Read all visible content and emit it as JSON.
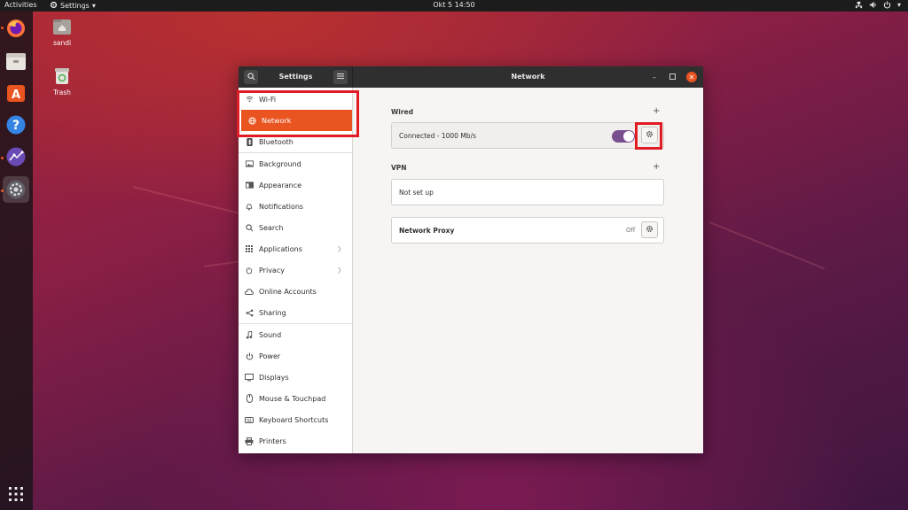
{
  "topbar": {
    "activities": "Activities",
    "app_menu": "Settings",
    "clock": "Okt 5  14:50"
  },
  "desktop": {
    "icons": [
      {
        "label": "sandi",
        "icon": "home-folder-icon"
      },
      {
        "label": "Trash",
        "icon": "trash-icon"
      }
    ]
  },
  "dock": {
    "items": [
      "firefox-icon",
      "files-icon",
      "software-icon",
      "help-icon",
      "shotwell-icon",
      "settings-icon"
    ],
    "show_apps": "apps-grid-icon"
  },
  "window": {
    "sidebar_title": "Settings",
    "panel_title": "Network"
  },
  "sidebar": {
    "items": [
      {
        "label": "Wi-Fi",
        "icon": "wifi-icon"
      },
      {
        "label": "Network",
        "icon": "network-icon"
      },
      {
        "label": "Bluetooth",
        "icon": "bluetooth-icon"
      },
      {
        "label": "Background",
        "icon": "background-icon"
      },
      {
        "label": "Appearance",
        "icon": "appearance-icon"
      },
      {
        "label": "Notifications",
        "icon": "bell-icon"
      },
      {
        "label": "Search",
        "icon": "search-icon"
      },
      {
        "label": "Applications",
        "icon": "applications-icon"
      },
      {
        "label": "Privacy",
        "icon": "hand-icon"
      },
      {
        "label": "Online Accounts",
        "icon": "cloud-icon"
      },
      {
        "label": "Sharing",
        "icon": "share-icon"
      },
      {
        "label": "Sound",
        "icon": "music-note-icon"
      },
      {
        "label": "Power",
        "icon": "power-icon"
      },
      {
        "label": "Displays",
        "icon": "display-icon"
      },
      {
        "label": "Mouse & Touchpad",
        "icon": "mouse-icon"
      },
      {
        "label": "Keyboard Shortcuts",
        "icon": "keyboard-icon"
      },
      {
        "label": "Printers",
        "icon": "printer-icon"
      }
    ]
  },
  "network": {
    "wired_title": "Wired",
    "wired_status": "Connected - 1000 Mb/s",
    "vpn_title": "VPN",
    "vpn_status": "Not set up",
    "proxy_label": "Network Proxy",
    "proxy_state": "Off"
  },
  "colors": {
    "accent": "#e95420",
    "toggle_on": "#7a4f8f",
    "highlight": "#e01b24"
  }
}
